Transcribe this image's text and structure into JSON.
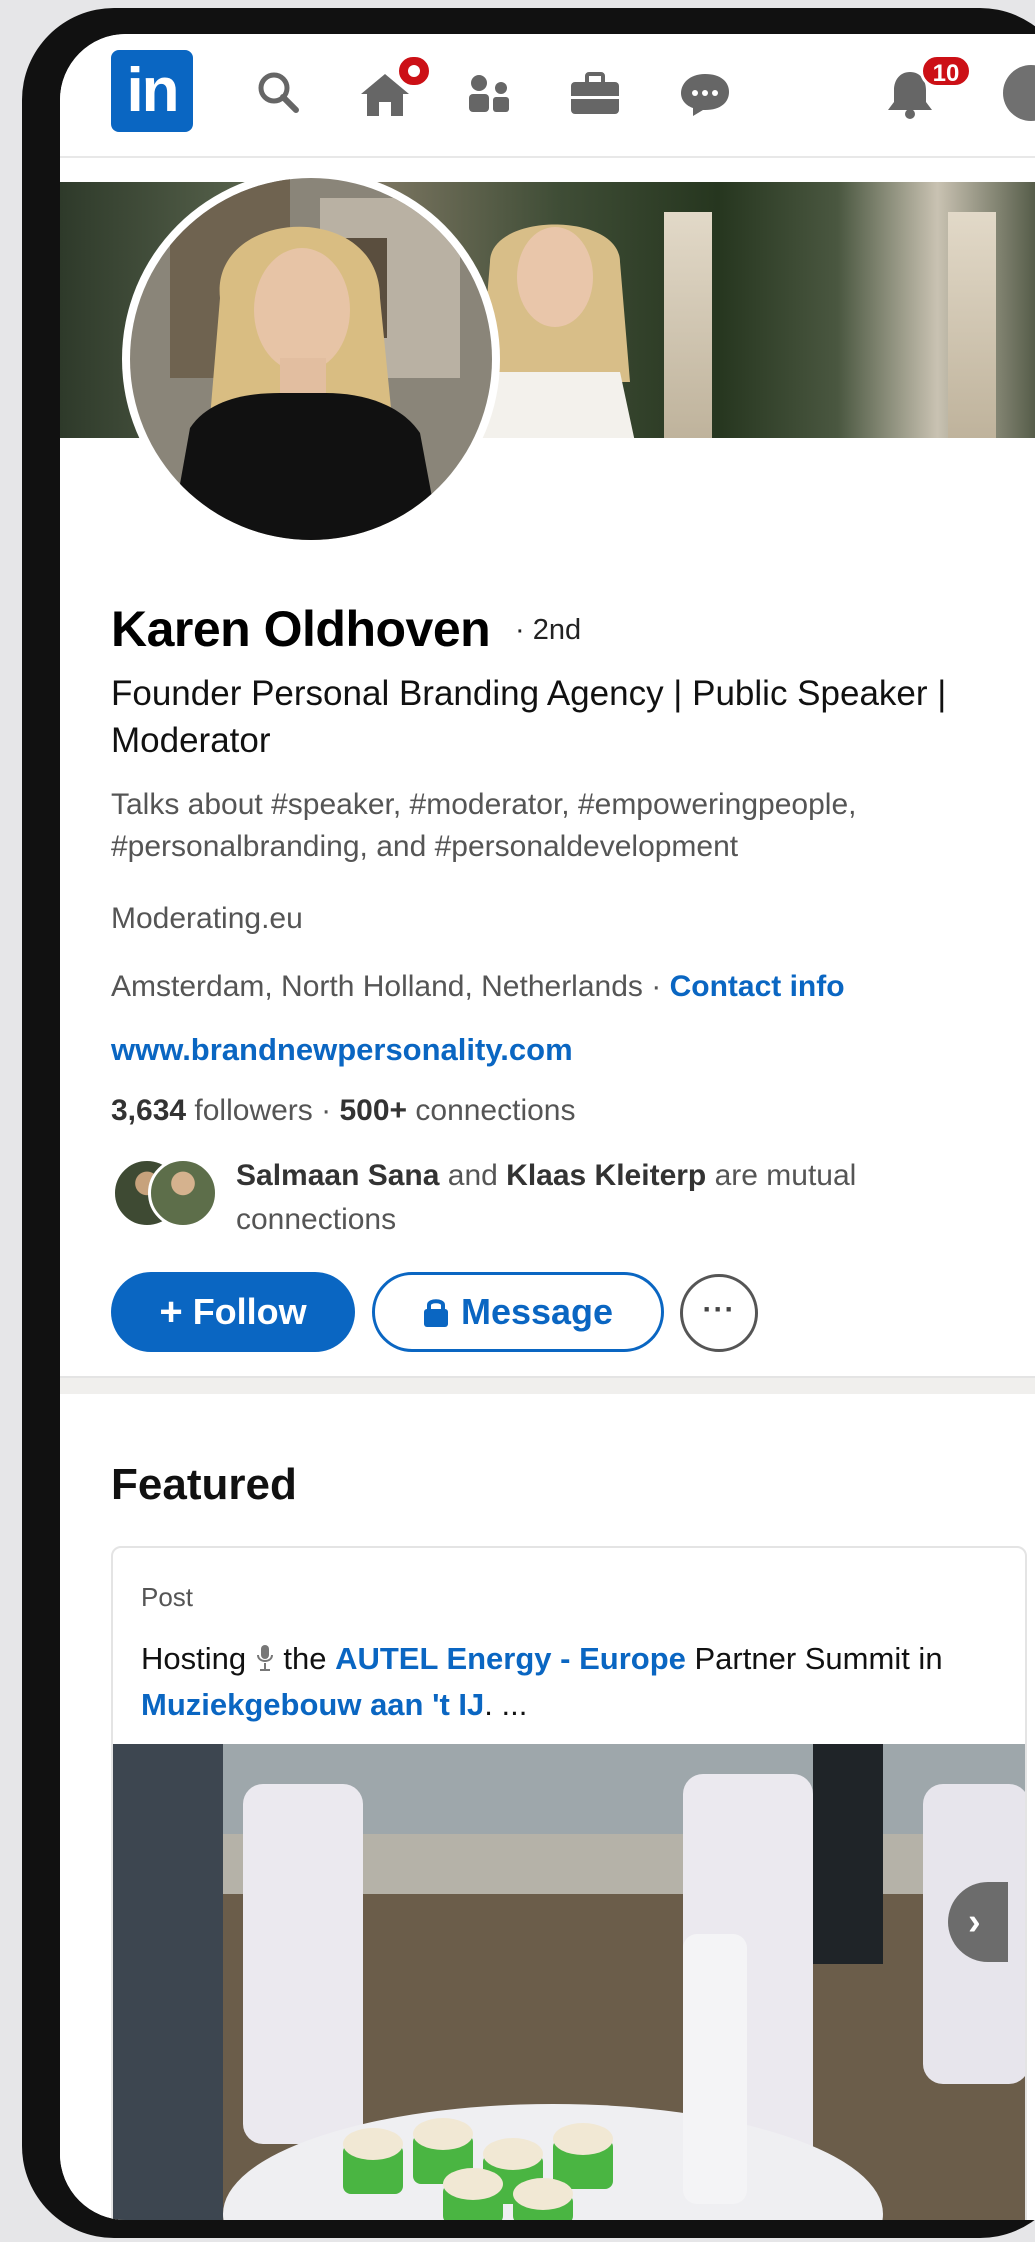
{
  "app": {
    "logo_text": "in"
  },
  "topbar": {
    "icons": [
      "search-icon",
      "home-icon",
      "my-network-icon",
      "jobs-icon",
      "messaging-icon",
      "notifications-icon",
      "me-avatar"
    ],
    "notifications_count": "10"
  },
  "profile": {
    "name": "Karen Oldhoven",
    "degree": "· 2nd",
    "headline": "Founder Personal Branding Agency | Public Speaker | Moderator",
    "talks_about": "Talks about #speaker, #moderator, #empoweringpeople, #personalbranding, and #personaldevelopment",
    "company": "Moderating.eu",
    "location": "Amsterdam, North Holland, Netherlands",
    "location_sep": " · ",
    "contact_info": "Contact info",
    "website": "www.brandnewpersonality.com",
    "followers_count": "3,634",
    "followers_label": " followers",
    "connections_sep": "  · ",
    "connections_count": "500+",
    "connections_label": " connections",
    "mutual_name1": "Salmaan Sana",
    "mutual_and": " and ",
    "mutual_name2": "Klaas Kleiterp",
    "mutual_suffix": " are mutual connections"
  },
  "actions": {
    "follow_label": "Follow",
    "follow_prefix": "+",
    "message_label": "Message",
    "more_label": "···"
  },
  "featured": {
    "title": "Featured",
    "card": {
      "type": "Post",
      "text_start": "Hosting ",
      "text_the": " the ",
      "link1": "AUTEL Energy - Europe",
      "text_mid": " Partner Summit in ",
      "link2": "Muziekgebouw aan 't IJ",
      "text_end": ". ..."
    },
    "next_arrow": "›"
  },
  "colors": {
    "linkedin_blue": "#0a66c2",
    "badge_red": "#cc1016"
  }
}
